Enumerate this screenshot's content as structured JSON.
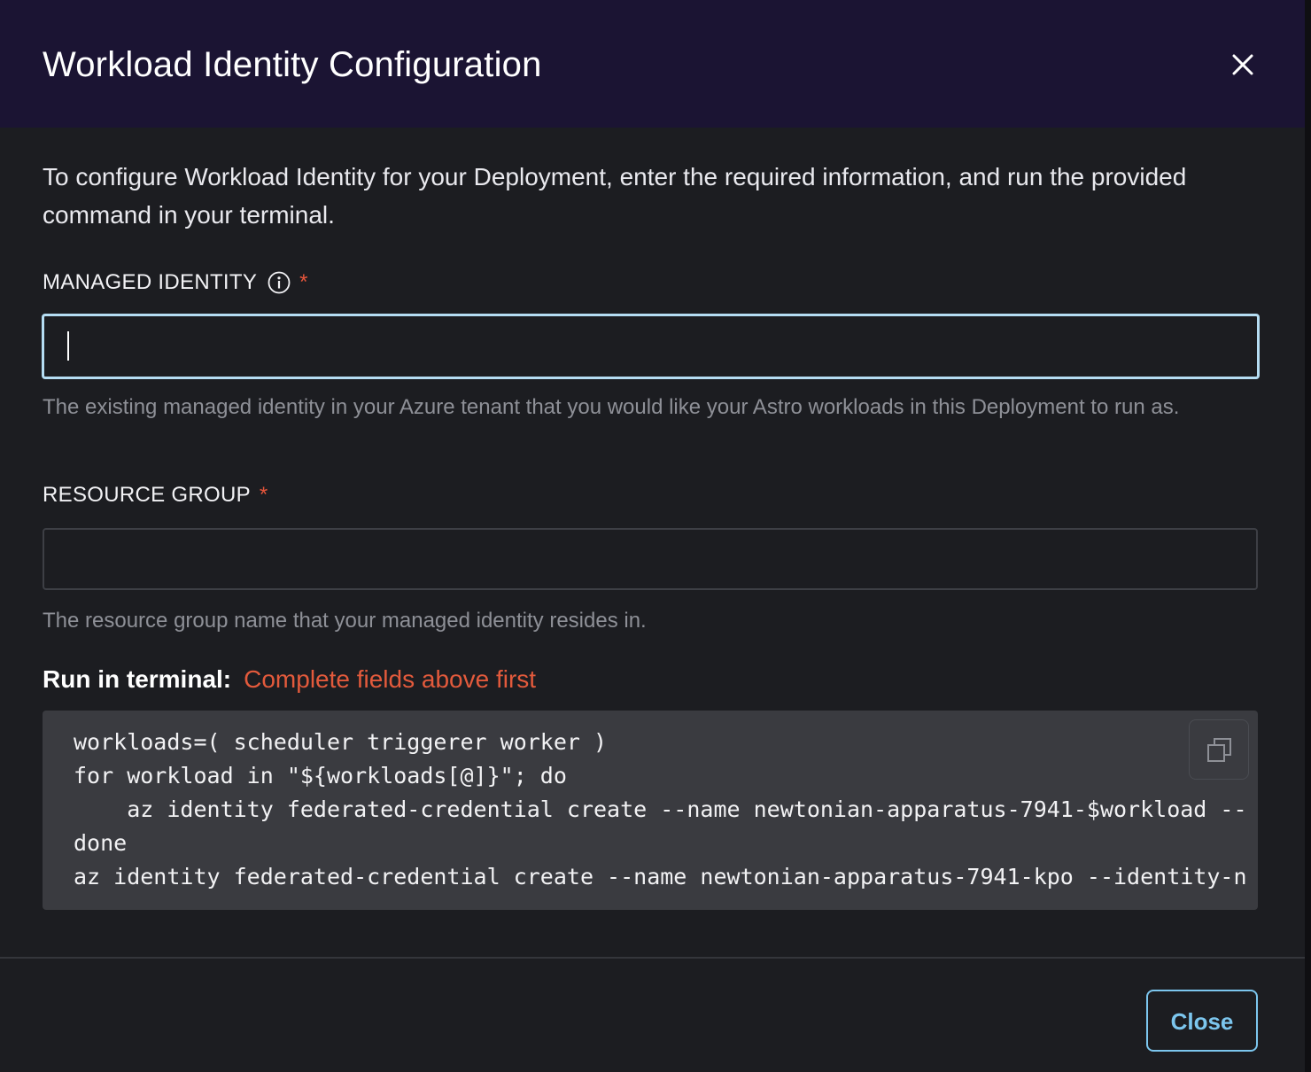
{
  "dialog": {
    "title": "Workload Identity Configuration",
    "intro": "To configure Workload Identity for your Deployment, enter the required information, and run the provided command in your terminal."
  },
  "managed_identity": {
    "label": "MANAGED IDENTITY",
    "required_mark": "*",
    "value": "",
    "help": "The existing managed identity in your Azure tenant that you would like your Astro workloads in this Deployment to run as."
  },
  "resource_group": {
    "label": "RESOURCE GROUP",
    "required_mark": "*",
    "value": "",
    "help": "The resource group name that your managed identity resides in."
  },
  "terminal": {
    "label": "Run in terminal:",
    "warning": "Complete fields above first",
    "lines": [
      "workloads=( scheduler triggerer worker )",
      "for workload in \"${workloads[@]}\"; do",
      "    az identity federated-credential create --name newtonian-apparatus-7941-$workload --",
      "done",
      "az identity federated-credential create --name newtonian-apparatus-7941-kpo --identity-n"
    ]
  },
  "footer": {
    "close_label": "Close"
  },
  "colors": {
    "header_bg": "#1b1433",
    "body_bg": "#1c1d21",
    "required": "#e6553b",
    "warning": "#e35a3c",
    "accent": "#7cc6ee",
    "focus_border": "#b5ddf3",
    "code_bg": "#3a3b40"
  }
}
